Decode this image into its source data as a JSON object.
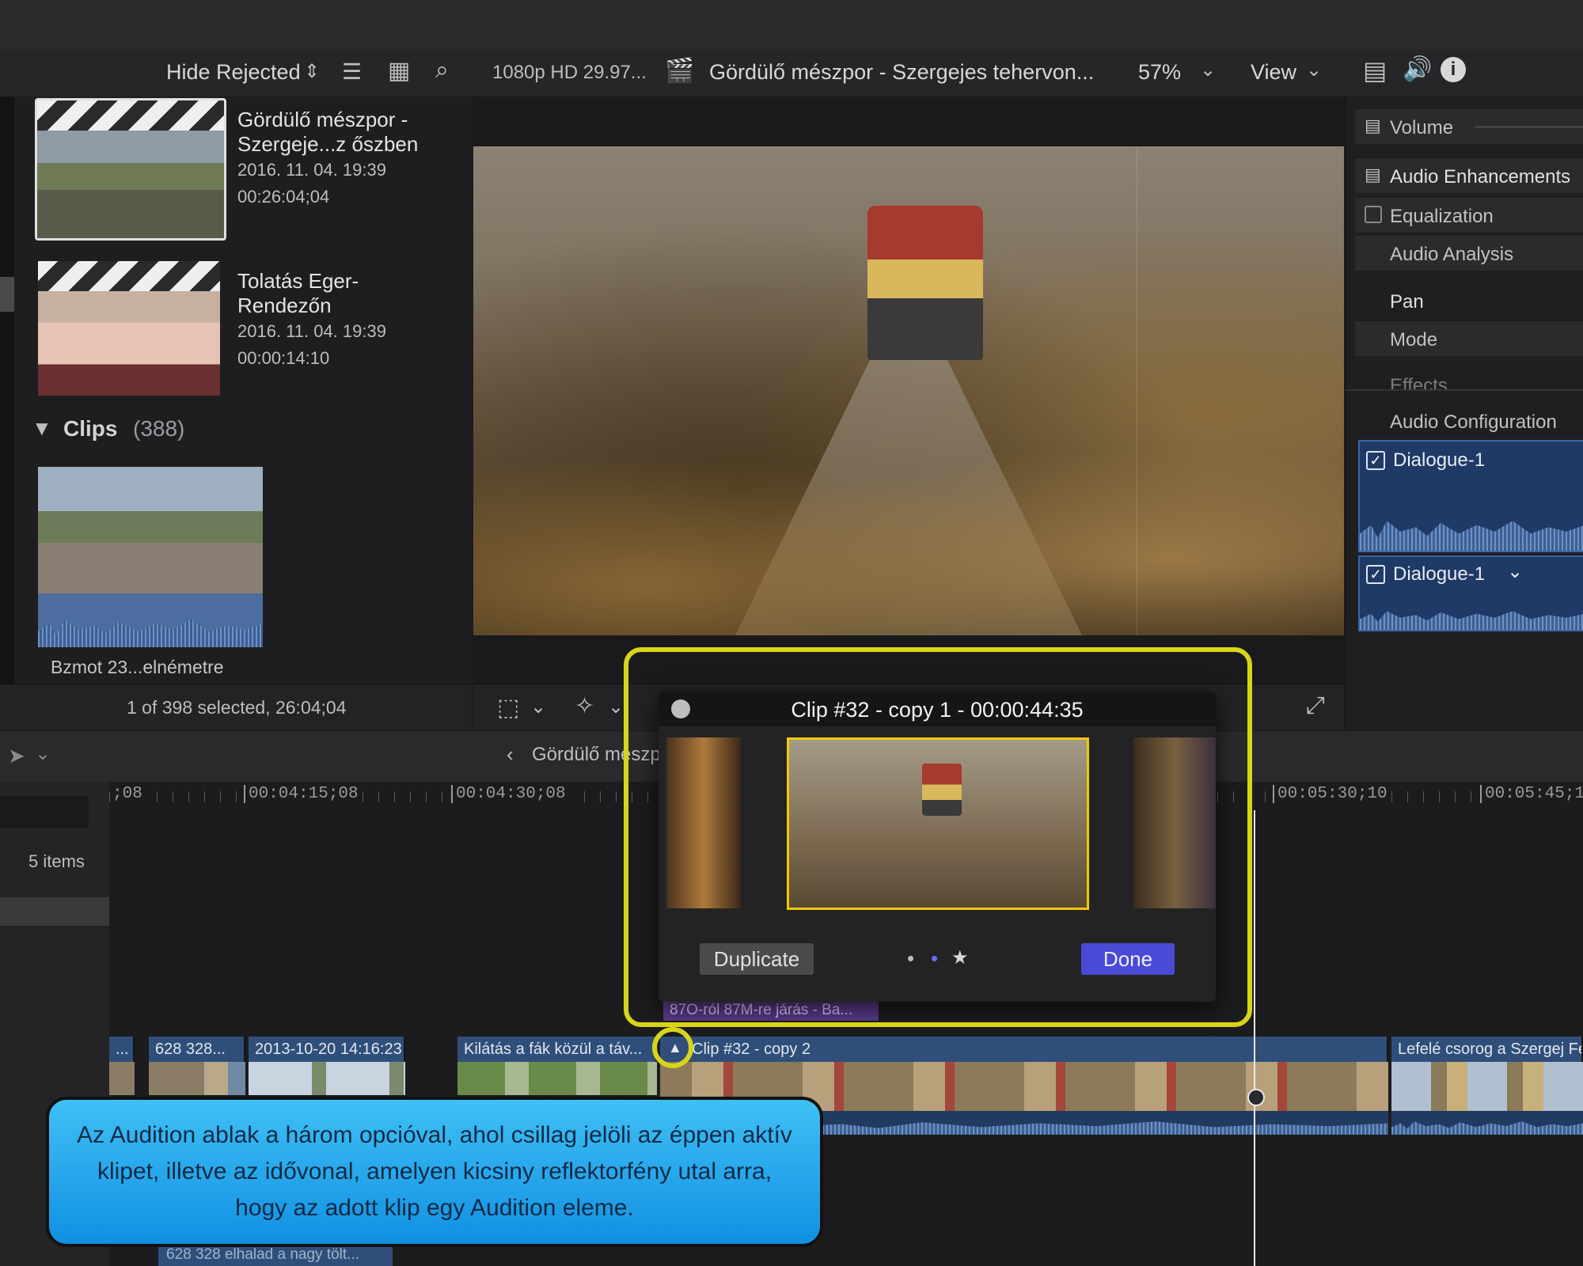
{
  "toolbar": {
    "filter": "Hide Rejected",
    "format": "1080p HD 29.97...",
    "project_title": "Gördülő mészpor - Szergejes tehervon...",
    "zoom": "57%",
    "view": "View"
  },
  "browser": {
    "events": [
      {
        "title_line1": "Gördülő mészpor -",
        "title_line2": "Szergeje...z őszben",
        "date": "2016. 11. 04. 19:39",
        "duration": "00:26:04;04"
      },
      {
        "title_line1": "Tolatás Eger-",
        "title_line2": "Rendezőn",
        "date": "2016. 11. 04. 19:39",
        "duration": "00:00:14:10"
      }
    ],
    "clips_header": "Clips",
    "clips_count": "(388)",
    "clip_name": "Bzmot 23...elnémetre",
    "status": "1 of 398 selected, 26:04;04"
  },
  "inspector": {
    "volume": "Volume",
    "audio_enhancements": "Audio Enhancements",
    "equalization": "Equalization",
    "audio_analysis": "Audio Analysis",
    "pan": "Pan",
    "mode": "Mode",
    "effects": "Effects",
    "audio_configuration": "Audio Configuration",
    "dialogue_1": "Dialogue-1",
    "dialogue_2": "Dialogue-1"
  },
  "timeline": {
    "breadcrumb": "Gördülő mészp",
    "items_count": "5 items",
    "ruler": [
      ";08",
      "00:04:15;08",
      "00:04:30;08",
      "00:05:30;10",
      "00:05:45;1"
    ],
    "connected_clip": "87O-ról 87M-re járás - Ba...",
    "clips": [
      "...",
      "628 328...",
      "2013-10-20 14:16:23",
      "Kilátás a fák közül a táv...",
      "Clip #32 - copy 2",
      "Lefelé csorog a Szergej Felnémet bejára"
    ],
    "lower_clip": "628 328 elhalad a nagy tölt..."
  },
  "audition": {
    "title": "Clip #32 - copy 1 - 00:00:44:35",
    "duplicate": "Duplicate",
    "done": "Done",
    "pager": [
      "•",
      "•",
      "★"
    ]
  },
  "callout": {
    "text": "Az Audition ablak a három opcióval, ahol csillag jelöli az éppen aktív klipet, illetve az idővonal, amelyen kicsiny reflektorfény utal arra, hogy az adott klip egy Audition  eleme."
  },
  "colors": {
    "highlight": "#d9d41a",
    "done_button": "#4a4ad6",
    "selection": "#f2c800",
    "clip_blue": "#2f4f7a"
  }
}
